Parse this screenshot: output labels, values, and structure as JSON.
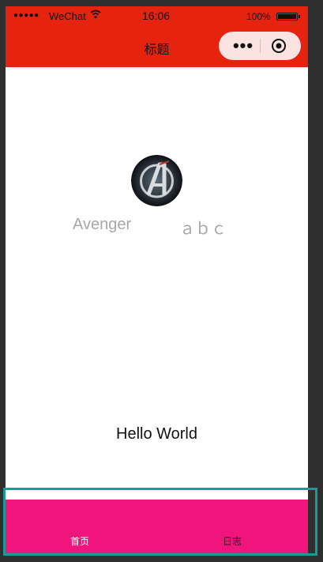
{
  "status_bar": {
    "signal": "●●●●●",
    "carrier": "WeChat",
    "wifi_icon": "wifi-icon",
    "time": "16:06",
    "battery_percent": "100%"
  },
  "nav_bar": {
    "title": "标题",
    "more": "•••",
    "background": "#e6230f"
  },
  "profile": {
    "name_left": "Avenger",
    "name_right": "ａｂｃ",
    "avatar_icon": "avengers-logo-icon"
  },
  "main": {
    "greeting": "Hello World"
  },
  "tabbar": {
    "background": "#f0157d",
    "items": [
      {
        "label": "首页"
      },
      {
        "label": "日志"
      }
    ]
  },
  "highlight": {
    "color": "#1a9b97"
  }
}
